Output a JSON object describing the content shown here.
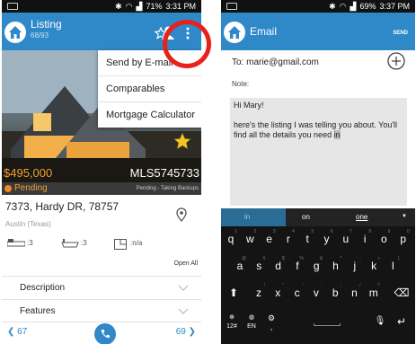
{
  "status_left": {
    "battery_text": "71%",
    "time": "3:31 PM"
  },
  "listing_bar": {
    "title": "Listing",
    "subtitle": "68/93"
  },
  "menu": [
    "Send by E-mail",
    "Comparables",
    "Mortgage Calculator"
  ],
  "listing": {
    "price": "$495,000",
    "mls": "MLS5745733",
    "status": "Pending",
    "status_detail": "Pending - Taking Backups",
    "address": "7373, Hardy DR, 78757",
    "city": "Austin (Texas)",
    "beds": ":3",
    "baths": ":3",
    "area": ":n/a",
    "open_all": "Open All",
    "sections": [
      "Description",
      "Features"
    ],
    "prev": "67",
    "next": "69"
  },
  "status_right": {
    "battery_text": "69%",
    "time": "3:37 PM"
  },
  "email_bar": {
    "title": "Email",
    "send": "SEND"
  },
  "email": {
    "to": "To: marie@gmail.com",
    "note_label": "Note:",
    "greeting": "Hi Mary!",
    "body": "here's the listing I was telling you about. You'll find all the details you need",
    "highlighted": "in"
  },
  "keyboard": {
    "suggestions": [
      "in",
      "on",
      "one"
    ],
    "row1": [
      "q",
      "w",
      "e",
      "r",
      "t",
      "y",
      "u",
      "i",
      "o",
      "p"
    ],
    "row1_alt": [
      "1",
      "2",
      "3",
      "4",
      "5",
      "6",
      "7",
      "8",
      "9",
      "0"
    ],
    "row2": [
      "a",
      "s",
      "d",
      "f",
      "g",
      "h",
      "j",
      "k",
      "l"
    ],
    "row2_alt": [
      "@",
      "#",
      "$",
      "%",
      "&",
      "*",
      "-",
      "+",
      "("
    ],
    "row3": [
      "z",
      "x",
      "c",
      "v",
      "b",
      "n",
      "m"
    ],
    "row3_alt": [
      "!",
      "\"",
      "'",
      ":",
      ";",
      "/",
      "?"
    ],
    "lang1": "12#",
    "lang2": "EN",
    "comma": ","
  },
  "colors": {
    "accent": "#2f89c8",
    "ring": "#e8211b",
    "pending": "#f08a24"
  }
}
